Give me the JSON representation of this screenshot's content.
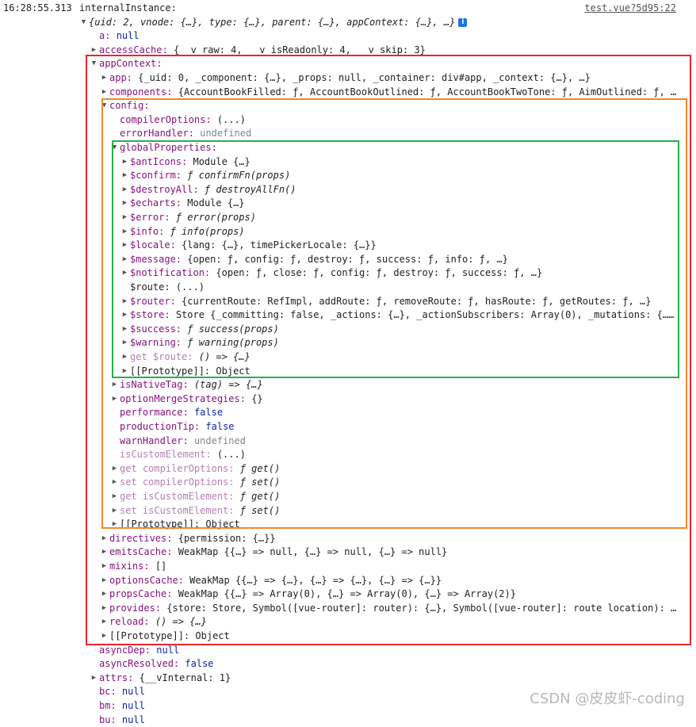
{
  "header": {
    "timestamp": "16:28:55.313",
    "source_link": "test.vue?5d95:22"
  },
  "watermark": "CSDN @皮皮虾-coding",
  "rows": [
    {
      "lvl": 0,
      "tri": "",
      "key": "internalInstance:",
      "kc": "plain",
      "val": "",
      "vc": ""
    },
    {
      "lvl": 1,
      "tri": "down",
      "key": "",
      "kc": "",
      "val": "{uid: 2, vnode: {…}, type: {…}, parent: {…}, appContext: {…}, …}",
      "vc": "ital",
      "info": "i"
    },
    {
      "lvl": 2,
      "tri": "",
      "key": "a:",
      "kc": "key",
      "val": "null",
      "vc": "kw"
    },
    {
      "lvl": 2,
      "tri": "right",
      "key": "accessCache:",
      "kc": "key",
      "val": "{__v_raw: 4, __v_isReadonly: 4, __v_skip: 3}",
      "vc": ""
    },
    {
      "lvl": 2,
      "tri": "down",
      "key": "appContext:",
      "kc": "key",
      "val": "",
      "vc": ""
    },
    {
      "lvl": 3,
      "tri": "right",
      "key": "app:",
      "kc": "key",
      "val": "{_uid: 0, _component: {…}, _props: null, _container: div#app, _context: {…}, …}",
      "vc": ""
    },
    {
      "lvl": 3,
      "tri": "right",
      "key": "components:",
      "kc": "key",
      "val": "{AccountBookFilled: ƒ, AccountBookOutlined: ƒ, AccountBookTwoTone: ƒ, AimOutlined: ƒ, …",
      "vc": ""
    },
    {
      "lvl": 3,
      "tri": "down",
      "key": "config:",
      "kc": "key",
      "val": "",
      "vc": ""
    },
    {
      "lvl": 4,
      "tri": "",
      "key": "compilerOptions:",
      "kc": "key",
      "val": "(...)",
      "vc": ""
    },
    {
      "lvl": 4,
      "tri": "",
      "key": "errorHandler:",
      "kc": "key",
      "val": "undefined",
      "vc": "undef"
    },
    {
      "lvl": 4,
      "tri": "down",
      "key": "globalProperties:",
      "kc": "key",
      "val": "",
      "vc": ""
    },
    {
      "lvl": 5,
      "tri": "right",
      "key": "$antIcons:",
      "kc": "key",
      "val": "Module {…}",
      "vc": ""
    },
    {
      "lvl": 5,
      "tri": "right",
      "key": "$confirm:",
      "kc": "key",
      "val": "ƒ confirmFn(props)",
      "vc": "ital"
    },
    {
      "lvl": 5,
      "tri": "right",
      "key": "$destroyAll:",
      "kc": "key",
      "val": "ƒ destroyAllFn()",
      "vc": "ital"
    },
    {
      "lvl": 5,
      "tri": "right",
      "key": "$echarts:",
      "kc": "key",
      "val": "Module {…}",
      "vc": ""
    },
    {
      "lvl": 5,
      "tri": "right",
      "key": "$error:",
      "kc": "key",
      "val": "ƒ error(props)",
      "vc": "ital"
    },
    {
      "lvl": 5,
      "tri": "right",
      "key": "$info:",
      "kc": "key",
      "val": "ƒ info(props)",
      "vc": "ital"
    },
    {
      "lvl": 5,
      "tri": "right",
      "key": "$locale:",
      "kc": "key",
      "val": "{lang: {…}, timePickerLocale: {…}}",
      "vc": ""
    },
    {
      "lvl": 5,
      "tri": "right",
      "key": "$message:",
      "kc": "key",
      "val": "{open: ƒ, config: ƒ, destroy: ƒ, success: ƒ, info: ƒ, …}",
      "vc": ""
    },
    {
      "lvl": 5,
      "tri": "right",
      "key": "$notification:",
      "kc": "key",
      "val": "{open: ƒ, close: ƒ, config: ƒ, destroy: ƒ, success: ƒ, …}",
      "vc": ""
    },
    {
      "lvl": 5,
      "tri": "",
      "key": "$route:",
      "kc": "plain",
      "val": "(...)",
      "vc": ""
    },
    {
      "lvl": 5,
      "tri": "right",
      "key": "$router:",
      "kc": "key",
      "val": "{currentRoute: RefImpl, addRoute: ƒ, removeRoute: ƒ, hasRoute: ƒ, getRoutes: ƒ, …}",
      "vc": ""
    },
    {
      "lvl": 5,
      "tri": "right",
      "key": "$store:",
      "kc": "key",
      "val": "Store {_committing: false, _actions: {…}, _actionSubscribers: Array(0), _mutations: {……",
      "vc": ""
    },
    {
      "lvl": 5,
      "tri": "right",
      "key": "$success:",
      "kc": "key",
      "val": "ƒ success(props)",
      "vc": "ital"
    },
    {
      "lvl": 5,
      "tri": "right",
      "key": "$warning:",
      "kc": "key",
      "val": "ƒ warning(props)",
      "vc": "ital"
    },
    {
      "lvl": 5,
      "tri": "right",
      "key": "get $route:",
      "kc": "dim",
      "val": "() => {…}",
      "vc": "ital"
    },
    {
      "lvl": 5,
      "tri": "right",
      "key": "[[Prototype]]:",
      "kc": "plain",
      "val": "Object",
      "vc": ""
    },
    {
      "lvl": 4,
      "tri": "right",
      "key": "isNativeTag:",
      "kc": "key",
      "val": "(tag) => {…}",
      "vc": "ital"
    },
    {
      "lvl": 4,
      "tri": "right",
      "key": "optionMergeStrategies:",
      "kc": "key",
      "val": "{}",
      "vc": ""
    },
    {
      "lvl": 4,
      "tri": "",
      "key": "performance:",
      "kc": "key",
      "val": "false",
      "vc": "kw"
    },
    {
      "lvl": 4,
      "tri": "",
      "key": "productionTip:",
      "kc": "key",
      "val": "false",
      "vc": "kw"
    },
    {
      "lvl": 4,
      "tri": "",
      "key": "warnHandler:",
      "kc": "key",
      "val": "undefined",
      "vc": "undef"
    },
    {
      "lvl": 4,
      "tri": "",
      "key": "isCustomElement:",
      "kc": "dim",
      "val": "(...)",
      "vc": ""
    },
    {
      "lvl": 4,
      "tri": "right",
      "key": "get compilerOptions:",
      "kc": "dim",
      "val": "ƒ get()",
      "vc": "ital"
    },
    {
      "lvl": 4,
      "tri": "right",
      "key": "set compilerOptions:",
      "kc": "dim",
      "val": "ƒ set()",
      "vc": "ital"
    },
    {
      "lvl": 4,
      "tri": "right",
      "key": "get isCustomElement:",
      "kc": "dim",
      "val": "ƒ get()",
      "vc": "ital"
    },
    {
      "lvl": 4,
      "tri": "right",
      "key": "set isCustomElement:",
      "kc": "dim",
      "val": "ƒ set()",
      "vc": "ital"
    },
    {
      "lvl": 4,
      "tri": "right",
      "key": "[[Prototype]]:",
      "kc": "plain",
      "val": "Object",
      "vc": ""
    },
    {
      "lvl": 3,
      "tri": "right",
      "key": "directives:",
      "kc": "key",
      "val": "{permission: {…}}",
      "vc": ""
    },
    {
      "lvl": 3,
      "tri": "right",
      "key": "emitsCache:",
      "kc": "key",
      "val": "WeakMap {{…} => null, {…} => null, {…} => null}",
      "vc": ""
    },
    {
      "lvl": 3,
      "tri": "right",
      "key": "mixins:",
      "kc": "key",
      "val": "[]",
      "vc": ""
    },
    {
      "lvl": 3,
      "tri": "right",
      "key": "optionsCache:",
      "kc": "key",
      "val": "WeakMap {{…} => {…}, {…} => {…}, {…} => {…}}",
      "vc": ""
    },
    {
      "lvl": 3,
      "tri": "right",
      "key": "propsCache:",
      "kc": "key",
      "val": "WeakMap {{…} => Array(0), {…} => Array(0), {…} => Array(2)}",
      "vc": ""
    },
    {
      "lvl": 3,
      "tri": "right",
      "key": "provides:",
      "kc": "key",
      "val": "{store: Store, Symbol([vue-router]: router): {…}, Symbol([vue-router]: route location): …",
      "vc": ""
    },
    {
      "lvl": 3,
      "tri": "right",
      "key": "reload:",
      "kc": "key",
      "val": "() => {…}",
      "vc": "ital"
    },
    {
      "lvl": 3,
      "tri": "right",
      "key": "[[Prototype]]:",
      "kc": "plain",
      "val": "Object",
      "vc": ""
    },
    {
      "lvl": 2,
      "tri": "",
      "key": "asyncDep:",
      "kc": "key",
      "val": "null",
      "vc": "kw"
    },
    {
      "lvl": 2,
      "tri": "",
      "key": "asyncResolved:",
      "kc": "key",
      "val": "false",
      "vc": "kw"
    },
    {
      "lvl": 2,
      "tri": "right",
      "key": "attrs:",
      "kc": "key",
      "val": "{__vInternal: 1}",
      "vc": ""
    },
    {
      "lvl": 2,
      "tri": "",
      "key": "bc:",
      "kc": "key",
      "val": "null",
      "vc": "kw"
    },
    {
      "lvl": 2,
      "tri": "",
      "key": "bm:",
      "kc": "key",
      "val": "null",
      "vc": "kw"
    },
    {
      "lvl": 2,
      "tri": "",
      "key": "bu:",
      "kc": "key",
      "val": "null",
      "vc": "kw"
    }
  ],
  "colors": {
    "highlight_appContext": "#e8262d",
    "highlight_config": "#f0892f",
    "highlight_globalProperties": "#25b14a"
  }
}
